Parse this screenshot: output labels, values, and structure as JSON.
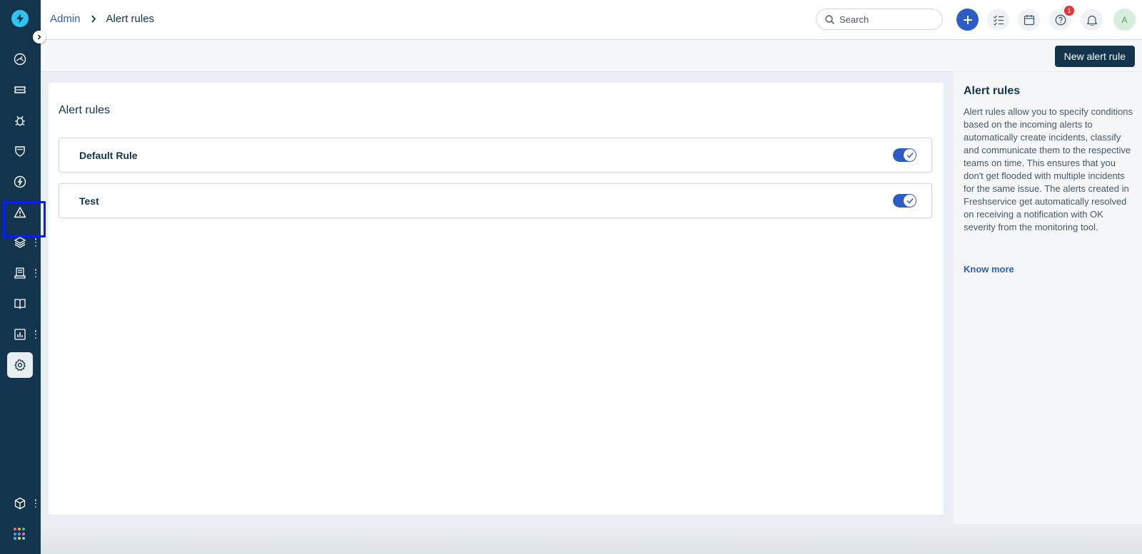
{
  "colors": {
    "sidebar_bg": "#12344d",
    "accent": "#2c5cc5",
    "primary_button": "#12344d",
    "badge": "#e43538",
    "selection_box": "#0b1ef0"
  },
  "sidebar": {
    "logo_icon": "freshservice-logo-icon",
    "expand_icon": "chevron-right-icon",
    "items": [
      {
        "icon": "dashboard-icon"
      },
      {
        "icon": "ticket-icon"
      },
      {
        "icon": "bug-icon"
      },
      {
        "icon": "shield-icon"
      },
      {
        "icon": "lightning-icon"
      },
      {
        "icon": "alert-triangle-icon",
        "highlighted": true
      },
      {
        "icon": "layers-icon",
        "has_menu": true
      },
      {
        "icon": "inventory-icon",
        "has_menu": true
      },
      {
        "icon": "book-icon"
      },
      {
        "icon": "reports-icon",
        "has_menu": true
      },
      {
        "icon": "gear-icon",
        "active": true
      },
      {
        "icon": "cube-icon",
        "has_menu": true
      }
    ],
    "apps_icon": "apps-grid-icon"
  },
  "header": {
    "breadcrumb_parent": "Admin",
    "breadcrumb_current": "Alert rules",
    "search_placeholder": "Search",
    "help_badge_count": "1",
    "avatar_initial": "A"
  },
  "toolbar": {
    "new_button_label": "New alert rule"
  },
  "main": {
    "title": "Alert rules",
    "rules": [
      {
        "name": "Default Rule",
        "enabled": true
      },
      {
        "name": "Test",
        "enabled": true
      }
    ]
  },
  "info_panel": {
    "title": "Alert rules",
    "description": "Alert rules allow you to specify conditions based on the incoming alerts to automatically create incidents, classify and communicate them to the respective teams on time. This ensures that you don't get flooded with multiple incidents for the same issue. The alerts created in Freshservice get automatically resolved on receiving a notification with OK severity from the monitoring tool.",
    "link_label": "Know more"
  }
}
